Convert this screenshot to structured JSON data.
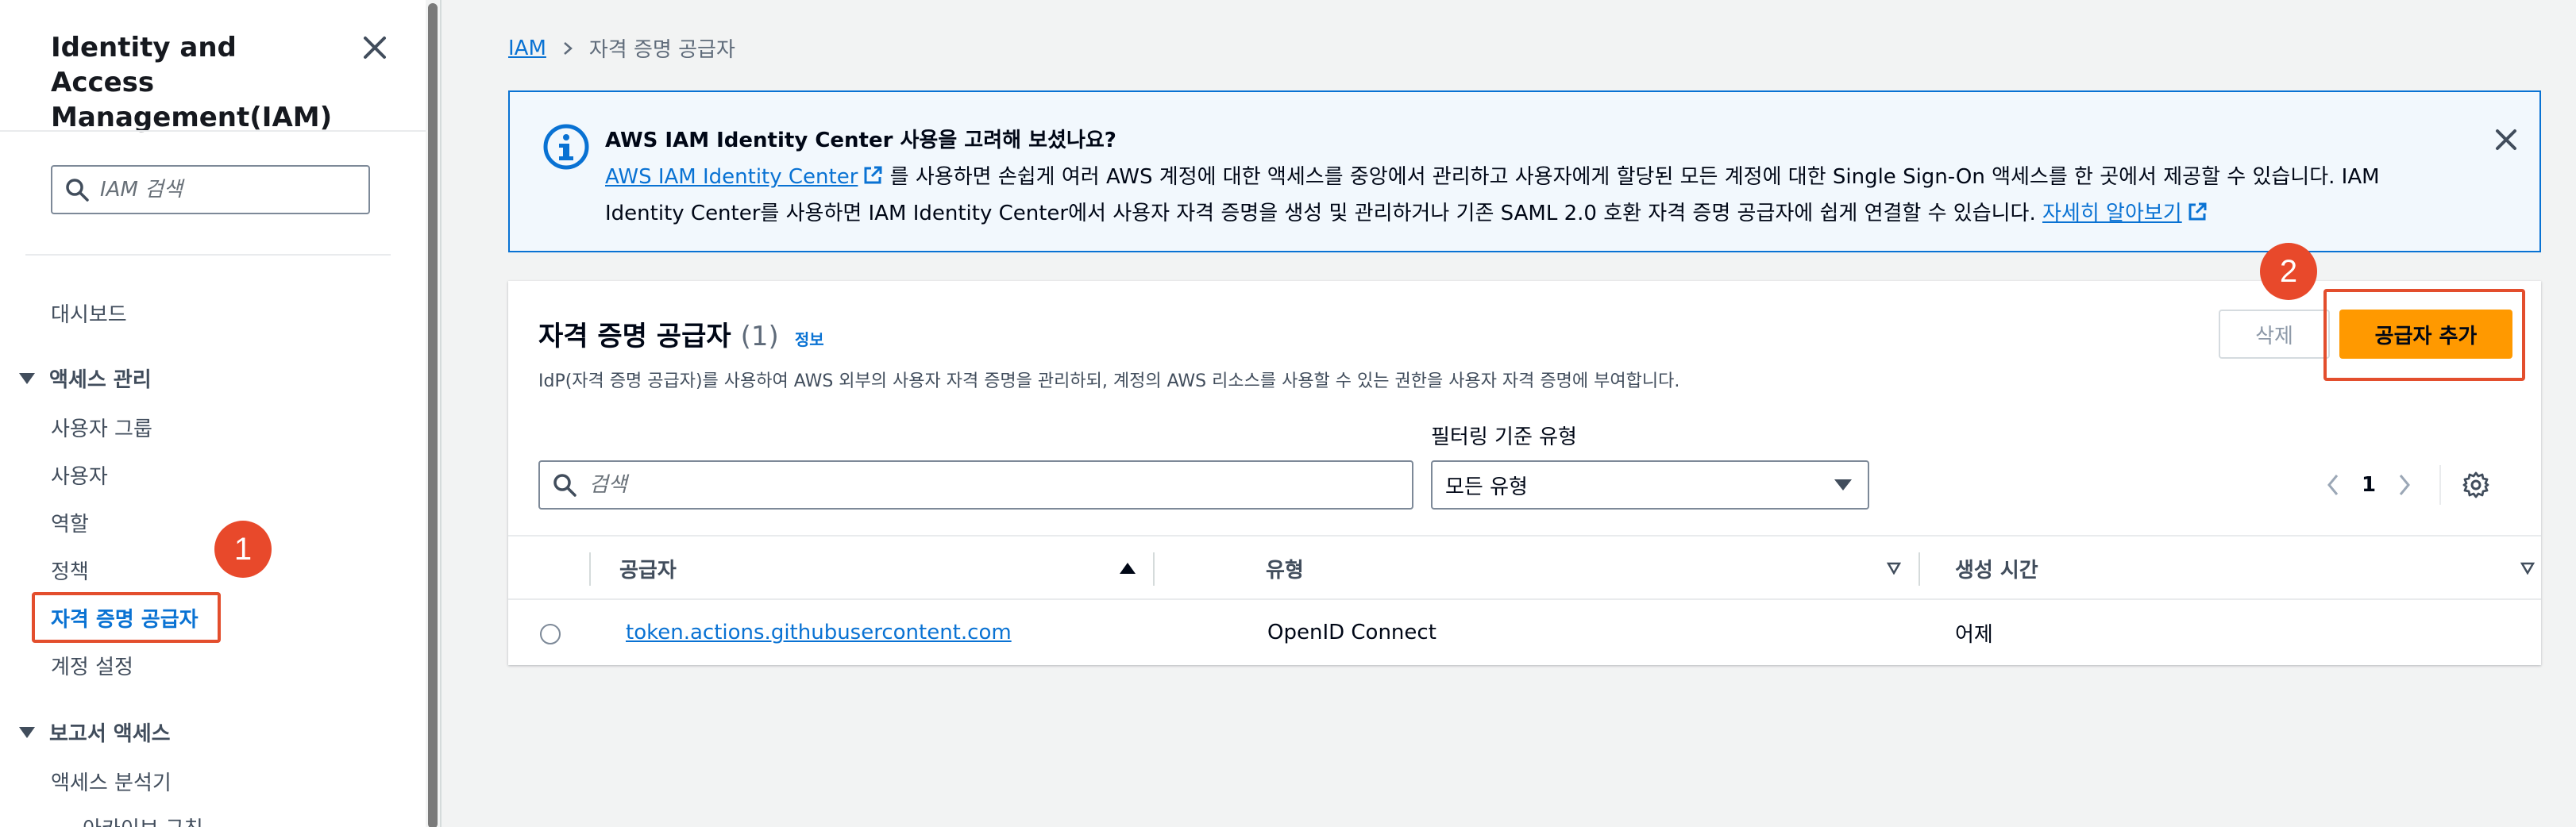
{
  "sidebar": {
    "title": "Identity and Access Management(IAM)",
    "search_placeholder": "IAM 검색",
    "dashboard": "대시보드",
    "section_access": "액세스 관리",
    "items": [
      "사용자 그룹",
      "사용자",
      "역할",
      "정책",
      "자격 증명 공급자",
      "계정 설정"
    ],
    "section_reports": "보고서 액세스",
    "report_items": [
      "액세스 분석기",
      "아카이브 규칙"
    ]
  },
  "annotations": {
    "badge1": "1",
    "badge2": "2",
    "highlight_color": "#e34e2d"
  },
  "breadcrumb": {
    "root": "IAM",
    "current": "자격 증명 공급자"
  },
  "flash": {
    "title": "AWS IAM Identity Center 사용을 고려해 보셨나요?",
    "link": "AWS IAM Identity Center",
    "body": " 를 사용하면 손쉽게 여러 AWS 계정에 대한 액세스를 중앙에서 관리하고 사용자에게 할당된 모든 계정에 대한 Single Sign-On 액세스를 한 곳에서 제공할 수 있습니다. IAM Identity Center를 사용하면 IAM Identity Center에서 사용자 자격 증명을 생성 및 관리하거나 기존 SAML 2.0 호환 자격 증명 공급자에 쉽게 연결할 수 있습니다. ",
    "learn_more": "자세히 알아보기"
  },
  "panel": {
    "title": "자격 증명 공급자",
    "count": "(1)",
    "info": "정보",
    "description": "IdP(자격 증명 공급자)를 사용하여 AWS 외부의 사용자 자격 증명을 관리하되, 계정의 AWS 리소스를 사용할 수 있는 권한을 사용자 자격 증명에 부여합니다.",
    "delete_label": "삭제",
    "add_label": "공급자 추가",
    "filter_label": "필터링 기준 유형",
    "search_placeholder": "검색",
    "filter_value": "모든 유형",
    "page": "1"
  },
  "table": {
    "columns": [
      "공급자",
      "유형",
      "생성 시간"
    ],
    "rows": [
      {
        "provider": "token.actions.githubusercontent.com",
        "type": "OpenID Connect",
        "created": "어제"
      }
    ]
  },
  "colors": {
    "accent": "#0972d3",
    "primary_button": "#ff9900",
    "annotation": "#e8492b"
  }
}
